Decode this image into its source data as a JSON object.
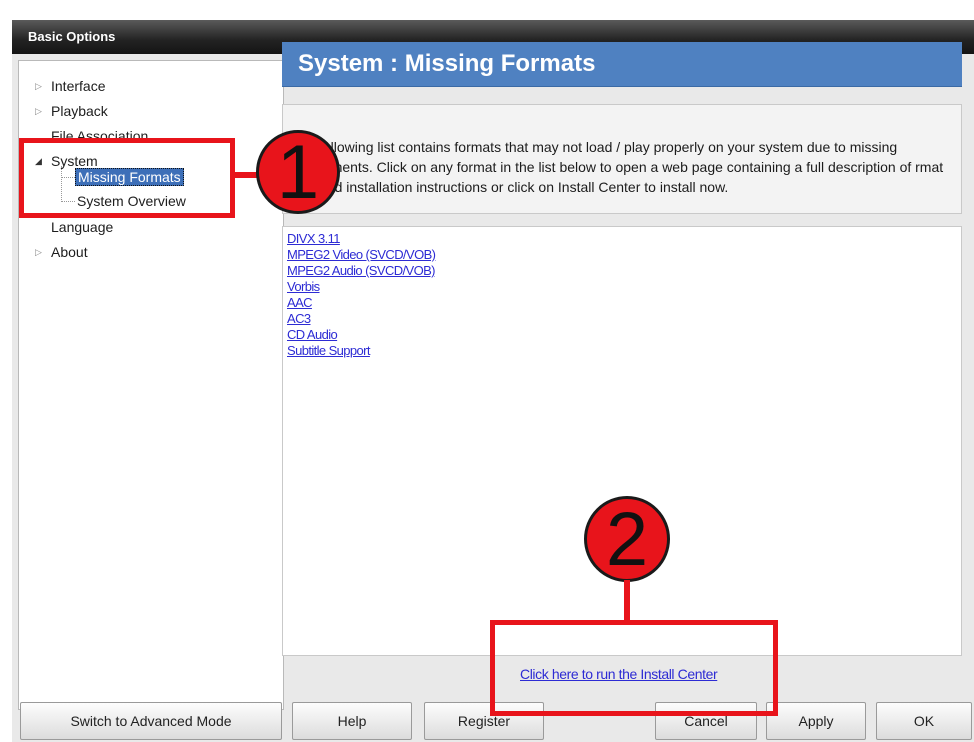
{
  "window": {
    "title": "Basic Options"
  },
  "tree": {
    "items": [
      {
        "label": "Interface"
      },
      {
        "label": "Playback"
      },
      {
        "label": "File Association"
      },
      {
        "label": "System"
      },
      {
        "label": "Missing Formats"
      },
      {
        "label": "System Overview"
      },
      {
        "label": "Language"
      },
      {
        "label": "About"
      }
    ]
  },
  "content": {
    "header": "System : Missing Formats",
    "description": "following list contains formats that may not load / play properly on your system due to missing ponents. Click on any format in the list below to open a web page containing a full description of rmat and installation instructions or click on Install Center to install now.",
    "formats": [
      "DIVX 3.11",
      "MPEG2 Video (SVCD/VOB)",
      "MPEG2 Audio (SVCD/VOB)",
      "Vorbis",
      "AAC",
      "AC3",
      "CD Audio",
      "Subtitle Support"
    ],
    "install_link": "Click here to run the Install Center"
  },
  "buttons": {
    "advanced": "Switch to Advanced Mode",
    "help": "Help",
    "register": "Register",
    "cancel": "Cancel",
    "apply": "Apply",
    "ok": "OK"
  },
  "annotations": {
    "marker1": "1",
    "marker2": "2",
    "color": "#e8141b"
  }
}
